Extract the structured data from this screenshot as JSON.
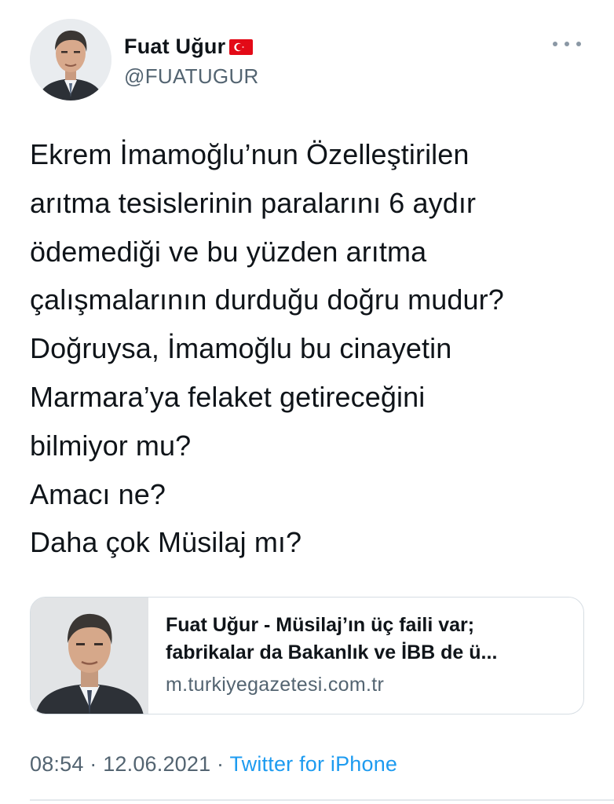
{
  "author": {
    "display_name": "Fuat Uğur",
    "handle": "@FUATUGUR",
    "badge_icon": "turkey-flag-icon",
    "avatar_icon": "profile-photo"
  },
  "more_icon": "more-horizontal-icon",
  "tweet_lines": [
    "Ekrem İmamoğlu’nun Özelleştirilen",
    "arıtma tesislerinin paralarını 6 aydır",
    "ödemediği ve bu yüzden arıtma",
    "çalışmalarının durduğu doğru mudur?",
    "Doğruysa, İmamoğlu bu cinayetin",
    "Marmara’ya felaket getireceğini",
    "bilmiyor mu?",
    "Amacı ne?",
    "Daha çok Müsilaj mı?"
  ],
  "link_card": {
    "thumbnail_icon": "article-thumbnail",
    "title_line1": "Fuat Uğur - Müsilaj’ın üç faili var;",
    "title_line2": "fabrikalar da Bakanlık ve İBB de ü...",
    "domain": "m.turkiyegazetesi.com.tr"
  },
  "meta": {
    "time": "08:54",
    "separator": "·",
    "date": "12.06.2021",
    "source": "Twitter for iPhone"
  },
  "colors": {
    "text_primary": "#0f1419",
    "text_secondary": "#536471",
    "link": "#1d9bf0",
    "border": "#d6dde3",
    "flag_red": "#e30a17"
  }
}
